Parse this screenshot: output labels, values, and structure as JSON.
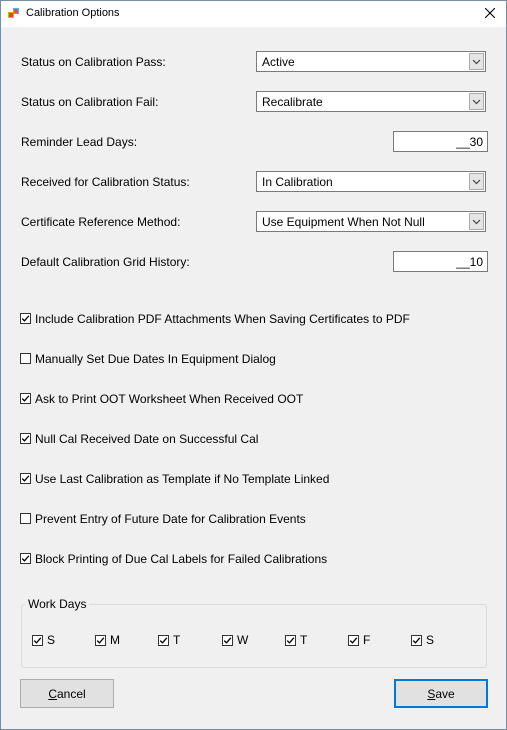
{
  "window": {
    "title": "Calibration Options"
  },
  "fields": {
    "pass_label": "Status on Calibration Pass:",
    "pass_value": "Active",
    "fail_label": "Status on Calibration Fail:",
    "fail_value": "Recalibrate",
    "lead_label": "Reminder Lead Days:",
    "lead_value": "__30",
    "received_label": "Received for Calibration Status:",
    "received_value": "In Calibration",
    "cert_label": "Certificate Reference Method:",
    "cert_value": "Use Equipment When Not Null",
    "history_label": "Default Calibration Grid History:",
    "history_value": "__10"
  },
  "options": [
    {
      "label": "Include Calibration PDF Attachments When Saving Certificates to PDF",
      "checked": true
    },
    {
      "label": "Manually Set Due Dates In Equipment Dialog",
      "checked": false
    },
    {
      "label": "Ask to Print OOT Worksheet When Received OOT",
      "checked": true
    },
    {
      "label": "Null Cal Received Date on Successful Cal",
      "checked": true
    },
    {
      "label": "Use Last Calibration as Template if No Template Linked",
      "checked": true
    },
    {
      "label": "Prevent Entry of Future Date for Calibration Events",
      "checked": false
    },
    {
      "label": "Block Printing of Due Cal Labels for Failed Calibrations",
      "checked": true
    }
  ],
  "work_days": {
    "title": "Work Days",
    "days": [
      {
        "label": "S",
        "checked": true
      },
      {
        "label": "M",
        "checked": true
      },
      {
        "label": "T",
        "checked": true
      },
      {
        "label": "W",
        "checked": true
      },
      {
        "label": "T",
        "checked": true
      },
      {
        "label": "F",
        "checked": true
      },
      {
        "label": "S",
        "checked": true
      }
    ]
  },
  "buttons": {
    "cancel_mnemonic": "C",
    "cancel_rest": "ancel",
    "save_mnemonic": "S",
    "save_rest": "ave"
  },
  "colors": {
    "default_button_border": "#0078d7",
    "window_bg": "#f0f0f0"
  }
}
